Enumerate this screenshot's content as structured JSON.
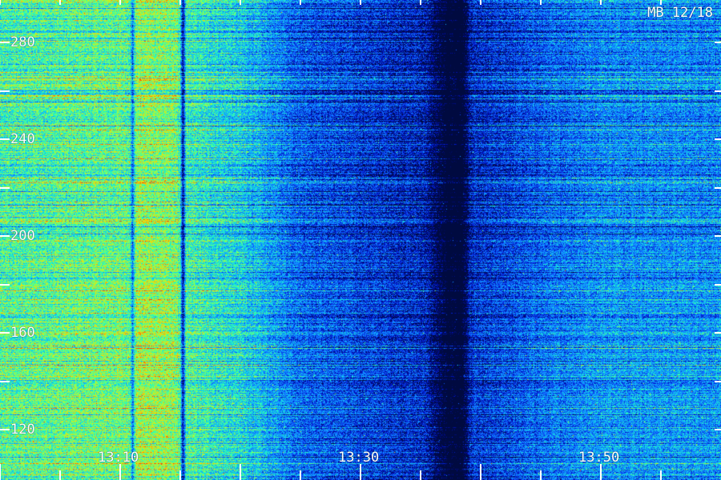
{
  "chart_data": {
    "type": "heatmap",
    "title": "MB 12/18",
    "x_axis": {
      "ticks": [
        "13:10",
        "13:30",
        "13:50"
      ],
      "range": [
        "13:00",
        "14:00"
      ],
      "minor_tick_interval_minutes": 5
    },
    "y_axis": {
      "ticks": [
        120,
        160,
        200,
        240,
        280
      ],
      "range": [
        100,
        290
      ],
      "minor_tick_interval": 20
    },
    "colormap": [
      "#000a40",
      "#0010c0",
      "#1060ff",
      "#10b0ff",
      "#20ffc0",
      "#a0ff40",
      "#ffd000",
      "#ff4000"
    ],
    "intensity_profile_by_time": {
      "13:00": 0.55,
      "13:05": 0.58,
      "13:10": 0.6,
      "13:15": 0.55,
      "13:20": 0.45,
      "13:25": 0.25,
      "13:30": 0.18,
      "13:35": 0.12,
      "13:40": 0.14,
      "13:45": 0.25,
      "13:50": 0.33,
      "13:55": 0.33,
      "14:00": 0.33
    },
    "grid": false
  }
}
